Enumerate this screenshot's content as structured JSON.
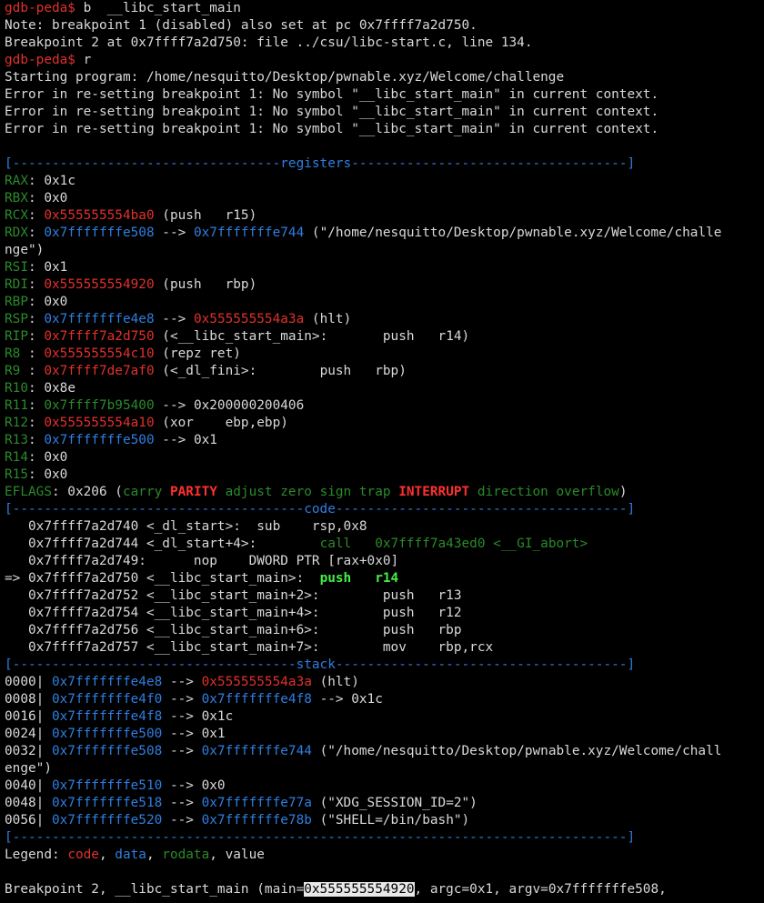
{
  "colors": {
    "default": "#d9d9d9",
    "prompt_red": "#e0312b",
    "code_red": "#e0312b",
    "register_green": "#2a8a2a",
    "data_blue": "#2f7ee0",
    "header_blue": "#2f7ee0",
    "bright_green": "#44ee44",
    "flag_red_bold": "#ff3030",
    "white": "#ffffff"
  },
  "terminal": {
    "lines": [
      [
        [
          "gdb-peda$ ",
          "prompt_red"
        ],
        [
          "b  __libc_start_main",
          "default"
        ]
      ],
      [
        [
          "Note: breakpoint 1 (disabled) also set at pc 0x7ffff7a2d750.",
          "default"
        ]
      ],
      [
        [
          "Breakpoint 2 at 0x7ffff7a2d750: file ../csu/libc-start.c, line 134.",
          "default"
        ]
      ],
      [
        [
          "gdb-peda$ ",
          "prompt_red"
        ],
        [
          "r",
          "default"
        ]
      ],
      [
        [
          "Starting program: /home/nesquitto/Desktop/pwnable.xyz/Welcome/challenge",
          "default"
        ]
      ],
      [
        [
          "Error in re-setting breakpoint 1: No symbol \"__libc_start_main\" in current context.",
          "default"
        ]
      ],
      [
        [
          "Error in re-setting breakpoint 1: No symbol \"__libc_start_main\" in current context.",
          "default"
        ]
      ],
      [
        [
          "Error in re-setting breakpoint 1: No symbol \"__libc_start_main\" in current context.",
          "default"
        ]
      ],
      [
        [
          "",
          "default"
        ]
      ],
      [
        [
          "[----------------------------------registers-----------------------------------]",
          "header_blue"
        ]
      ],
      [
        [
          "RAX",
          "register_green"
        ],
        [
          ": 0x1c",
          "default"
        ]
      ],
      [
        [
          "RBX",
          "register_green"
        ],
        [
          ": 0x0",
          "default"
        ]
      ],
      [
        [
          "RCX",
          "register_green"
        ],
        [
          ": ",
          "default"
        ],
        [
          "0x555555554ba0",
          "code_red"
        ],
        [
          " (push   r15)",
          "default"
        ]
      ],
      [
        [
          "RDX",
          "register_green"
        ],
        [
          ": ",
          "default"
        ],
        [
          "0x7fffffffe508",
          "data_blue"
        ],
        [
          " --> ",
          "default"
        ],
        [
          "0x7fffffffe744",
          "data_blue"
        ],
        [
          " (\"/home/nesquitto/Desktop/pwnable.xyz/Welcome/challe",
          "default"
        ]
      ],
      [
        [
          "nge\")",
          "default"
        ]
      ],
      [
        [
          "RSI",
          "register_green"
        ],
        [
          ": 0x1",
          "default"
        ]
      ],
      [
        [
          "RDI",
          "register_green"
        ],
        [
          ": ",
          "default"
        ],
        [
          "0x555555554920",
          "code_red"
        ],
        [
          " (push   rbp)",
          "default"
        ]
      ],
      [
        [
          "RBP",
          "register_green"
        ],
        [
          ": 0x0",
          "default"
        ]
      ],
      [
        [
          "RSP",
          "register_green"
        ],
        [
          ": ",
          "default"
        ],
        [
          "0x7fffffffe4e8",
          "data_blue"
        ],
        [
          " --> ",
          "default"
        ],
        [
          "0x555555554a3a",
          "code_red"
        ],
        [
          " (hlt)",
          "default"
        ]
      ],
      [
        [
          "RIP",
          "register_green"
        ],
        [
          ": ",
          "default"
        ],
        [
          "0x7ffff7a2d750",
          "code_red"
        ],
        [
          " (<__libc_start_main>:       push   r14)",
          "default"
        ]
      ],
      [
        [
          "R8 ",
          "register_green"
        ],
        [
          ": ",
          "default"
        ],
        [
          "0x555555554c10",
          "code_red"
        ],
        [
          " (repz ret)",
          "default"
        ]
      ],
      [
        [
          "R9 ",
          "register_green"
        ],
        [
          ": ",
          "default"
        ],
        [
          "0x7ffff7de7af0",
          "code_red"
        ],
        [
          " (<_dl_fini>:        push   rbp)",
          "default"
        ]
      ],
      [
        [
          "R10",
          "register_green"
        ],
        [
          ": 0x8e",
          "default"
        ]
      ],
      [
        [
          "R11",
          "register_green"
        ],
        [
          ": ",
          "default"
        ],
        [
          "0x7ffff7b95400",
          "register_green"
        ],
        [
          " --> 0x200000200406",
          "default"
        ]
      ],
      [
        [
          "R12",
          "register_green"
        ],
        [
          ": ",
          "default"
        ],
        [
          "0x555555554a10",
          "code_red"
        ],
        [
          " (xor    ebp,ebp)",
          "default"
        ]
      ],
      [
        [
          "R13",
          "register_green"
        ],
        [
          ": ",
          "default"
        ],
        [
          "0x7fffffffe500",
          "data_blue"
        ],
        [
          " --> 0x1",
          "default"
        ]
      ],
      [
        [
          "R14",
          "register_green"
        ],
        [
          ": 0x0",
          "default"
        ]
      ],
      [
        [
          "R15",
          "register_green"
        ],
        [
          ": 0x0",
          "default"
        ]
      ],
      [
        [
          "EFLAGS",
          "register_green"
        ],
        [
          ": 0x206 (",
          "default"
        ],
        [
          "carry ",
          "register_green"
        ],
        [
          "PARITY",
          "flag_red_bold"
        ],
        [
          " adjust zero sign trap ",
          "register_green"
        ],
        [
          "INTERRUPT",
          "flag_red_bold"
        ],
        [
          " direction overflow",
          "register_green"
        ],
        [
          ")",
          "default"
        ]
      ],
      [
        [
          "[-------------------------------------code-------------------------------------]",
          "header_blue"
        ]
      ],
      [
        [
          "   0x7ffff7a2d740 <_dl_start>:  sub    rsp,0x8",
          "default"
        ]
      ],
      [
        [
          "   0x7ffff7a2d744 <_dl_start+4>:        ",
          "default"
        ],
        [
          "call   0x7ffff7a43ed0 <__GI_abort>",
          "register_green"
        ]
      ],
      [
        [
          "   0x7ffff7a2d749:      nop    DWORD PTR [rax+0x0]",
          "default"
        ]
      ],
      [
        [
          "=> 0x7ffff7a2d750 <__libc_start_main>:  ",
          "default"
        ],
        [
          "push   r14",
          "bright_green"
        ]
      ],
      [
        [
          "   0x7ffff7a2d752 <__libc_start_main+2>:        push   r13",
          "default"
        ]
      ],
      [
        [
          "   0x7ffff7a2d754 <__libc_start_main+4>:        push   r12",
          "default"
        ]
      ],
      [
        [
          "   0x7ffff7a2d756 <__libc_start_main+6>:        push   rbp",
          "default"
        ]
      ],
      [
        [
          "   0x7ffff7a2d757 <__libc_start_main+7>:        mov    rbp,rcx",
          "default"
        ]
      ],
      [
        [
          "[------------------------------------stack-------------------------------------]",
          "header_blue"
        ]
      ],
      [
        [
          "0000| ",
          "default"
        ],
        [
          "0x7fffffffe4e8",
          "data_blue"
        ],
        [
          " --> ",
          "default"
        ],
        [
          "0x555555554a3a",
          "code_red"
        ],
        [
          " (hlt)",
          "default"
        ]
      ],
      [
        [
          "0008| ",
          "default"
        ],
        [
          "0x7fffffffe4f0",
          "data_blue"
        ],
        [
          " --> ",
          "default"
        ],
        [
          "0x7fffffffe4f8",
          "data_blue"
        ],
        [
          " --> 0x1c",
          "default"
        ]
      ],
      [
        [
          "0016| ",
          "default"
        ],
        [
          "0x7fffffffe4f8",
          "data_blue"
        ],
        [
          " --> 0x1c",
          "default"
        ]
      ],
      [
        [
          "0024| ",
          "default"
        ],
        [
          "0x7fffffffe500",
          "data_blue"
        ],
        [
          " --> 0x1",
          "default"
        ]
      ],
      [
        [
          "0032| ",
          "default"
        ],
        [
          "0x7fffffffe508",
          "data_blue"
        ],
        [
          " --> ",
          "default"
        ],
        [
          "0x7fffffffe744",
          "data_blue"
        ],
        [
          " (\"/home/nesquitto/Desktop/pwnable.xyz/Welcome/chall",
          "default"
        ]
      ],
      [
        [
          "enge\")",
          "default"
        ]
      ],
      [
        [
          "0040| ",
          "default"
        ],
        [
          "0x7fffffffe510",
          "data_blue"
        ],
        [
          " --> 0x0",
          "default"
        ]
      ],
      [
        [
          "0048| ",
          "default"
        ],
        [
          "0x7fffffffe518",
          "data_blue"
        ],
        [
          " --> ",
          "default"
        ],
        [
          "0x7fffffffe77a",
          "data_blue"
        ],
        [
          " (\"XDG_SESSION_ID=2\")",
          "default"
        ]
      ],
      [
        [
          "0056| ",
          "default"
        ],
        [
          "0x7fffffffe520",
          "data_blue"
        ],
        [
          " --> ",
          "default"
        ],
        [
          "0x7fffffffe78b",
          "data_blue"
        ],
        [
          " (\"SHELL=/bin/bash\")",
          "default"
        ]
      ],
      [
        [
          "[------------------------------------------------------------------------------]",
          "header_blue"
        ]
      ],
      [
        [
          "Legend: ",
          "default"
        ],
        [
          "code",
          "code_red"
        ],
        [
          ", ",
          "default"
        ],
        [
          "data",
          "data_blue"
        ],
        [
          ", ",
          "default"
        ],
        [
          "rodata",
          "register_green"
        ],
        [
          ", value",
          "default"
        ]
      ],
      [
        [
          "",
          "default"
        ]
      ],
      [
        [
          "Breakpoint 2, __libc_start_main (main=",
          "default"
        ],
        [
          "0x555555554920",
          "selected"
        ],
        [
          ", argc=0x1, argv=0x7fffffffe508,",
          "default"
        ]
      ]
    ]
  }
}
